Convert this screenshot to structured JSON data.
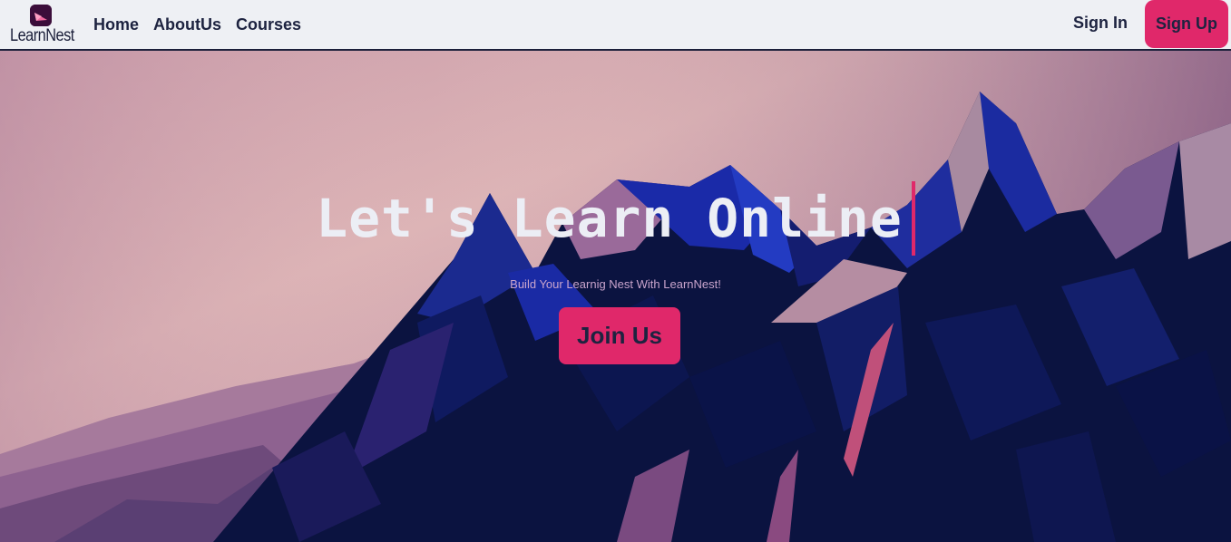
{
  "brand": {
    "name": "LearnNest"
  },
  "nav": {
    "links": [
      "Home",
      "AboutUs",
      "Courses"
    ],
    "signin_label": "Sign In",
    "signup_label": "Sign Up"
  },
  "hero": {
    "headline": "Let's Learn Online",
    "subtitle": "Build Your Learnig Nest With LearnNest!",
    "cta_label": "Join Us"
  },
  "colors": {
    "accent": "#e0286a",
    "navy": "#1d2340",
    "nav_bg": "#eef0f4",
    "mountain_dark": "#0b1340",
    "mountain_blue": "#1a2a9c"
  }
}
